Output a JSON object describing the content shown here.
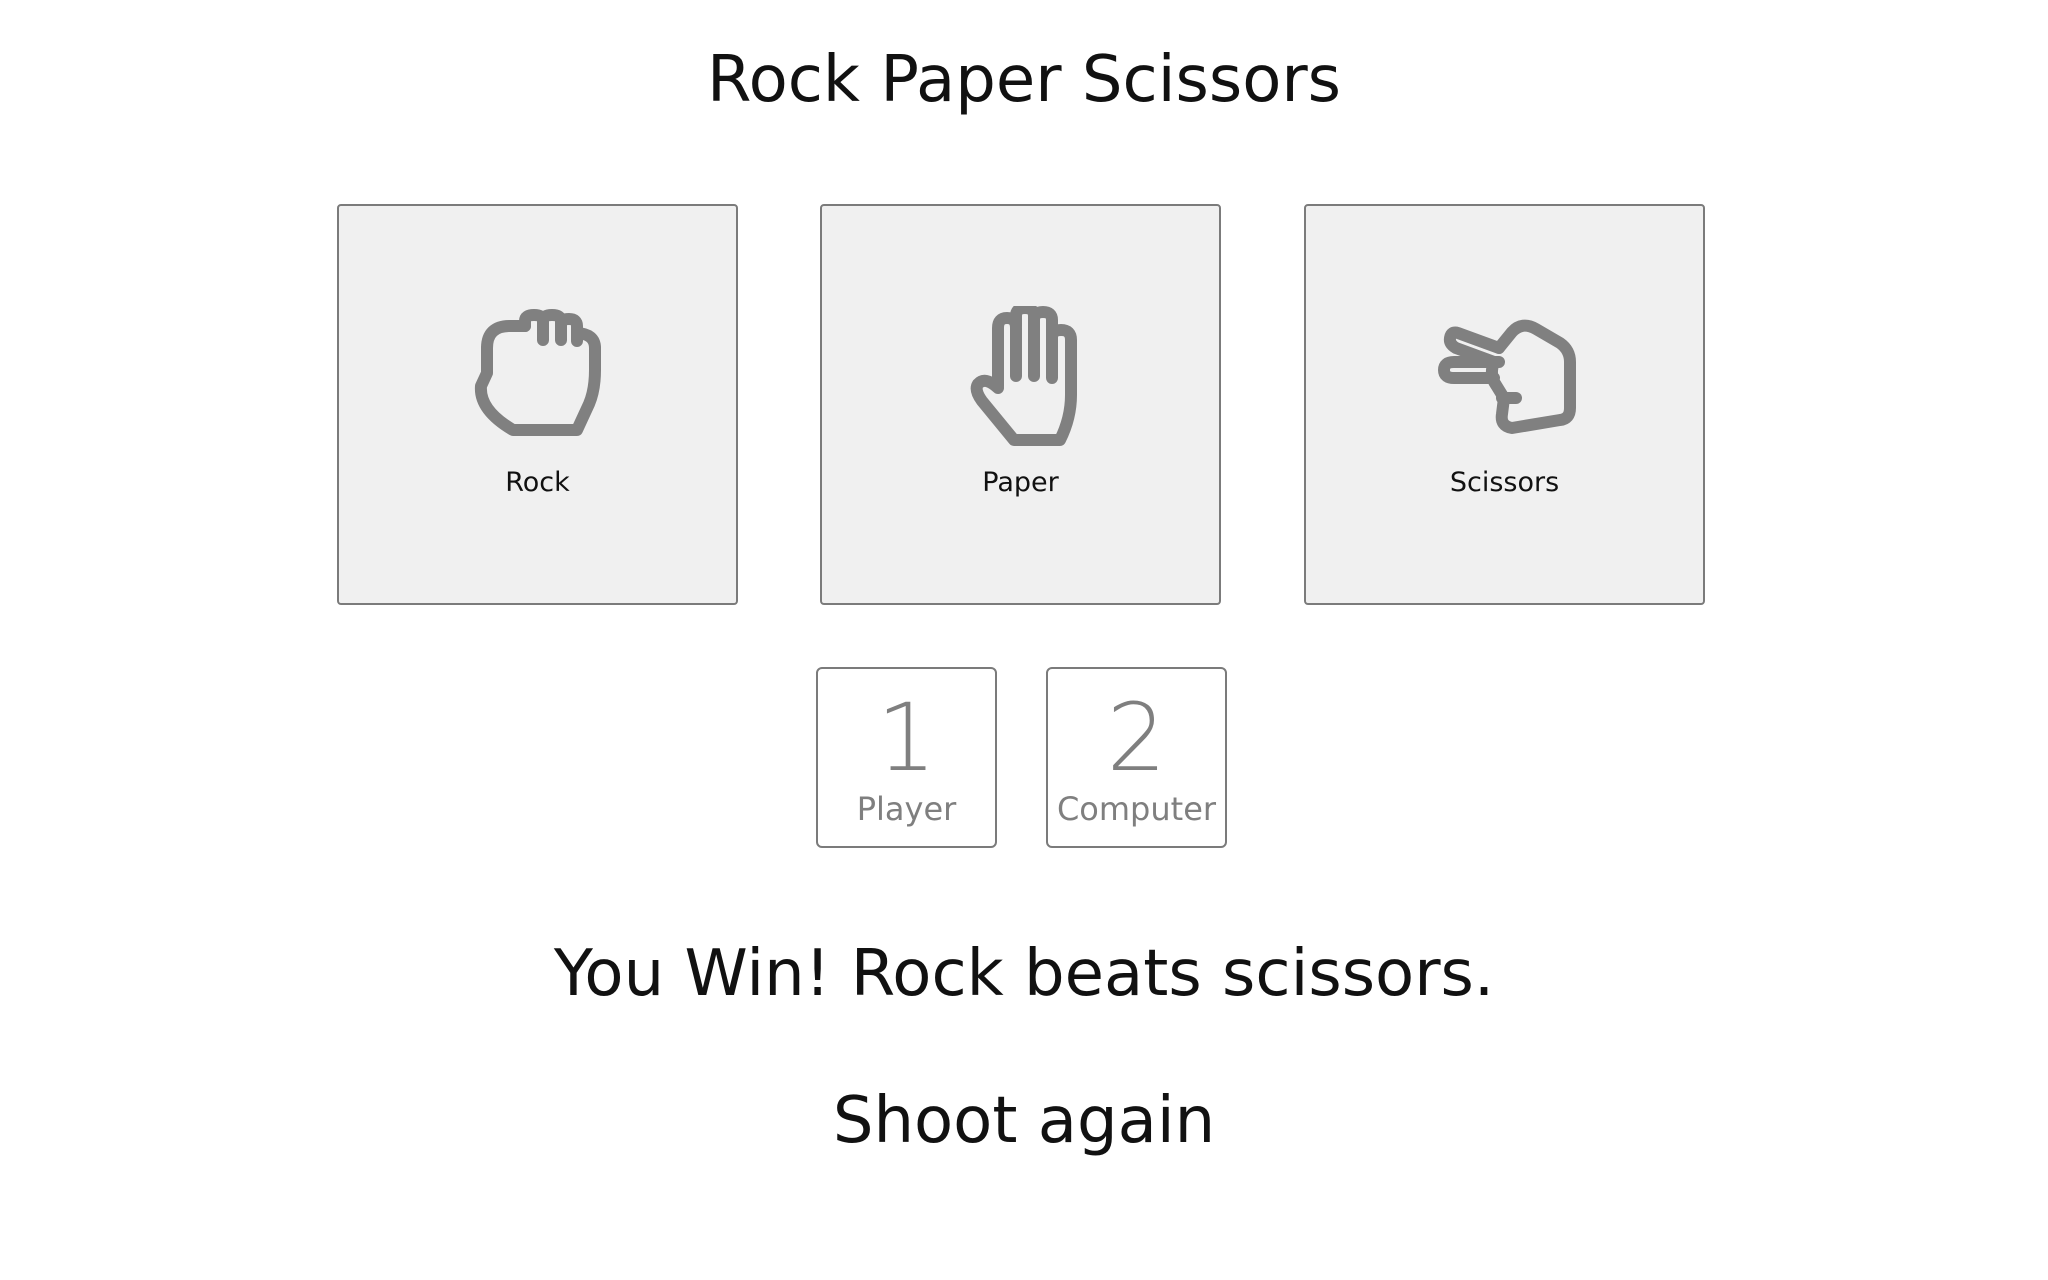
{
  "header": {
    "title": "Rock Paper Scissors"
  },
  "choices": [
    {
      "label": "Rock",
      "icon": "rock-hand-icon"
    },
    {
      "label": "Paper",
      "icon": "paper-hand-icon"
    },
    {
      "label": "Scissors",
      "icon": "scissors-hand-icon"
    }
  ],
  "scoreboard": {
    "player": {
      "value": "1",
      "label": "Player"
    },
    "computer": {
      "value": "2",
      "label": "Computer"
    }
  },
  "result": {
    "message": "You Win! Rock beats scissors."
  },
  "actions": {
    "shoot_again": "Shoot again"
  },
  "colors": {
    "card_background": "#f0f0f0",
    "card_border": "#7b7b7b",
    "icon_gray": "#808080",
    "score_gray": "#7f7f7f",
    "text_dark": "#111111"
  }
}
